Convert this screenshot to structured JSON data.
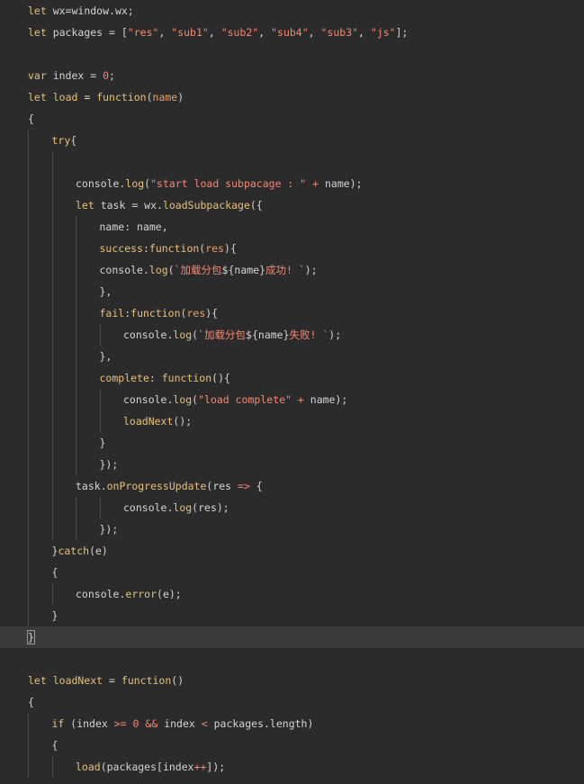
{
  "colors": {
    "background": "#2b2b2b",
    "current_line": "#3a3a3a",
    "indent_guide": "#4b4b4b",
    "keyword": "#e5c07b",
    "plain": "#d4d4d4",
    "string": "#f48771",
    "function": "#e5c07b",
    "param": "#e8a06c",
    "number": "#f48771",
    "operator": "#f48771",
    "property": "#d4d4d4",
    "method": "#e5c07b"
  },
  "editor": {
    "cursor_line": 29,
    "lines": [
      {
        "indent": 0,
        "tokens": [
          [
            "keyword",
            "let"
          ],
          [
            "plain",
            " wx=window.wx;"
          ]
        ]
      },
      {
        "indent": 0,
        "tokens": [
          [
            "keyword",
            "let"
          ],
          [
            "plain",
            " packages = ["
          ],
          [
            "string",
            "\"res\""
          ],
          [
            "plain",
            ", "
          ],
          [
            "string",
            "\"sub1\""
          ],
          [
            "plain",
            ", "
          ],
          [
            "string",
            "\"sub2\""
          ],
          [
            "plain",
            ", "
          ],
          [
            "string",
            "\"sub4\""
          ],
          [
            "plain",
            ", "
          ],
          [
            "string",
            "\"sub3\""
          ],
          [
            "plain",
            ", "
          ],
          [
            "string",
            "\"js\""
          ],
          [
            "plain",
            "];"
          ]
        ]
      },
      {
        "indent": 0,
        "tokens": []
      },
      {
        "indent": 0,
        "tokens": [
          [
            "keyword",
            "var"
          ],
          [
            "plain",
            " index = "
          ],
          [
            "number",
            "0"
          ],
          [
            "plain",
            ";"
          ]
        ]
      },
      {
        "indent": 0,
        "tokens": [
          [
            "keyword",
            "let"
          ],
          [
            "plain",
            " "
          ],
          [
            "function",
            "load"
          ],
          [
            "plain",
            " = "
          ],
          [
            "keyword",
            "function"
          ],
          [
            "plain",
            "("
          ],
          [
            "param",
            "name"
          ],
          [
            "plain",
            ")"
          ]
        ]
      },
      {
        "indent": 0,
        "tokens": [
          [
            "plain",
            "{"
          ]
        ]
      },
      {
        "indent": 1,
        "tokens": [
          [
            "keyword",
            "try"
          ],
          [
            "plain",
            "{"
          ]
        ]
      },
      {
        "indent": 2,
        "tokens": []
      },
      {
        "indent": 2,
        "tokens": [
          [
            "plain",
            "console."
          ],
          [
            "method",
            "log"
          ],
          [
            "plain",
            "("
          ],
          [
            "string",
            "\"start load subpacage : \""
          ],
          [
            "plain",
            " "
          ],
          [
            "operator",
            "+"
          ],
          [
            "plain",
            " name);"
          ]
        ]
      },
      {
        "indent": 2,
        "tokens": [
          [
            "keyword",
            "let"
          ],
          [
            "plain",
            " task = wx."
          ],
          [
            "method",
            "loadSubpackage"
          ],
          [
            "plain",
            "({"
          ]
        ]
      },
      {
        "indent": 3,
        "tokens": [
          [
            "plain",
            "name: name,"
          ]
        ]
      },
      {
        "indent": 3,
        "tokens": [
          [
            "method",
            "success"
          ],
          [
            "plain",
            ":"
          ],
          [
            "keyword",
            "function"
          ],
          [
            "plain",
            "("
          ],
          [
            "param",
            "res"
          ],
          [
            "plain",
            "){"
          ]
        ]
      },
      {
        "indent": 3,
        "tokens": [
          [
            "plain",
            "console."
          ],
          [
            "method",
            "log"
          ],
          [
            "plain",
            "("
          ],
          [
            "string",
            "`加载分包"
          ],
          [
            "plain",
            "${name}"
          ],
          [
            "string",
            "成功! `"
          ],
          [
            "plain",
            ");"
          ]
        ]
      },
      {
        "indent": 3,
        "tokens": [
          [
            "plain",
            "},"
          ]
        ]
      },
      {
        "indent": 3,
        "tokens": [
          [
            "method",
            "fail"
          ],
          [
            "plain",
            ":"
          ],
          [
            "keyword",
            "function"
          ],
          [
            "plain",
            "("
          ],
          [
            "param",
            "res"
          ],
          [
            "plain",
            "){"
          ]
        ]
      },
      {
        "indent": 4,
        "tokens": [
          [
            "plain",
            "console."
          ],
          [
            "method",
            "log"
          ],
          [
            "plain",
            "("
          ],
          [
            "string",
            "`加载分包"
          ],
          [
            "plain",
            "${name}"
          ],
          [
            "string",
            "失败! `"
          ],
          [
            "plain",
            ");"
          ]
        ]
      },
      {
        "indent": 3,
        "tokens": [
          [
            "plain",
            "},"
          ]
        ]
      },
      {
        "indent": 3,
        "tokens": [
          [
            "method",
            "complete"
          ],
          [
            "plain",
            ": "
          ],
          [
            "keyword",
            "function"
          ],
          [
            "plain",
            "(){"
          ]
        ]
      },
      {
        "indent": 4,
        "tokens": [
          [
            "plain",
            "console."
          ],
          [
            "method",
            "log"
          ],
          [
            "plain",
            "("
          ],
          [
            "string",
            "\"load complete\""
          ],
          [
            "plain",
            " "
          ],
          [
            "operator",
            "+"
          ],
          [
            "plain",
            " name);"
          ]
        ]
      },
      {
        "indent": 4,
        "tokens": [
          [
            "method",
            "loadNext"
          ],
          [
            "plain",
            "();"
          ]
        ]
      },
      {
        "indent": 3,
        "tokens": [
          [
            "plain",
            "}"
          ]
        ]
      },
      {
        "indent": 3,
        "tokens": [
          [
            "plain",
            "});"
          ]
        ]
      },
      {
        "indent": 2,
        "tokens": [
          [
            "plain",
            "task."
          ],
          [
            "method",
            "onProgressUpdate"
          ],
          [
            "plain",
            "(res "
          ],
          [
            "operator",
            "=>"
          ],
          [
            "plain",
            " {"
          ]
        ]
      },
      {
        "indent": 4,
        "tokens": [
          [
            "plain",
            "console."
          ],
          [
            "method",
            "log"
          ],
          [
            "plain",
            "(res);"
          ]
        ]
      },
      {
        "indent": 3,
        "tokens": [
          [
            "plain",
            "});"
          ]
        ]
      },
      {
        "indent": 1,
        "tokens": [
          [
            "plain",
            "}"
          ],
          [
            "keyword",
            "catch"
          ],
          [
            "plain",
            "(e)"
          ]
        ]
      },
      {
        "indent": 1,
        "tokens": [
          [
            "plain",
            "{"
          ]
        ]
      },
      {
        "indent": 2,
        "tokens": [
          [
            "plain",
            "console."
          ],
          [
            "method",
            "error"
          ],
          [
            "plain",
            "(e);"
          ]
        ]
      },
      {
        "indent": 1,
        "tokens": [
          [
            "plain",
            "}"
          ]
        ]
      },
      {
        "indent": 0,
        "tokens": [
          [
            "plain",
            "}"
          ]
        ]
      },
      {
        "indent": 0,
        "tokens": []
      },
      {
        "indent": 0,
        "tokens": [
          [
            "keyword",
            "let"
          ],
          [
            "plain",
            " "
          ],
          [
            "function",
            "loadNext"
          ],
          [
            "plain",
            " = "
          ],
          [
            "keyword",
            "function"
          ],
          [
            "plain",
            "()"
          ]
        ]
      },
      {
        "indent": 0,
        "tokens": [
          [
            "plain",
            "{"
          ]
        ]
      },
      {
        "indent": 1,
        "tokens": [
          [
            "keyword",
            "if"
          ],
          [
            "plain",
            " (index "
          ],
          [
            "operator",
            ">="
          ],
          [
            "plain",
            " "
          ],
          [
            "number",
            "0"
          ],
          [
            "plain",
            " "
          ],
          [
            "operator",
            "&&"
          ],
          [
            "plain",
            " index "
          ],
          [
            "operator",
            "<"
          ],
          [
            "plain",
            " packages.length)"
          ]
        ]
      },
      {
        "indent": 1,
        "tokens": [
          [
            "plain",
            "{"
          ]
        ]
      },
      {
        "indent": 2,
        "tokens": [
          [
            "method",
            "load"
          ],
          [
            "plain",
            "(packages[index"
          ],
          [
            "operator",
            "++"
          ],
          [
            "plain",
            "]);"
          ]
        ]
      }
    ]
  }
}
